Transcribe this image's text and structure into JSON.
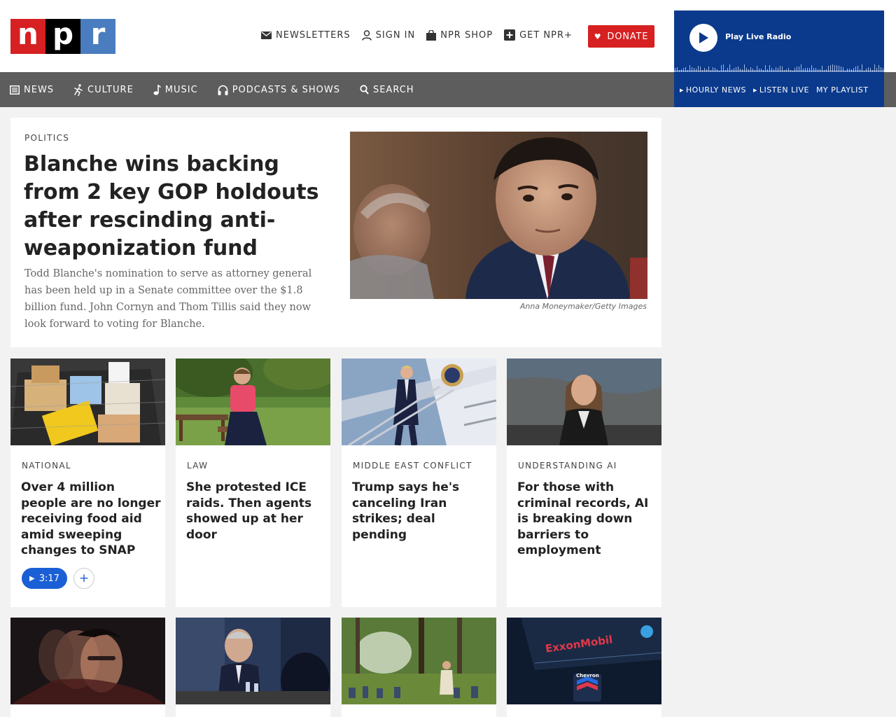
{
  "logo": {
    "n": "n",
    "p": "p",
    "r": "r"
  },
  "utility_nav": [
    {
      "label": "NEWSLETTERS",
      "icon": "envelope-icon"
    },
    {
      "label": "SIGN IN",
      "icon": "user-icon"
    },
    {
      "label": "NPR SHOP",
      "icon": "bag-icon"
    },
    {
      "label": "GET NPR+",
      "icon": "plus-square-icon"
    }
  ],
  "donate": {
    "label": "DONATE",
    "icon": "heart-icon"
  },
  "player": {
    "play_label": "Play Live Radio",
    "links": [
      "HOURLY NEWS",
      "LISTEN LIVE",
      "MY PLAYLIST"
    ]
  },
  "main_nav": [
    {
      "label": "NEWS",
      "icon": "news-icon"
    },
    {
      "label": "CULTURE",
      "icon": "culture-icon"
    },
    {
      "label": "MUSIC",
      "icon": "music-note-icon"
    },
    {
      "label": "PODCASTS & SHOWS",
      "icon": "headphones-icon"
    },
    {
      "label": "SEARCH",
      "icon": "search-icon"
    }
  ],
  "lead_story": {
    "category": "POLITICS",
    "title": "Blanche wins backing from 2 key GOP holdouts after rescinding anti-weaponization fund",
    "teaser": "Todd Blanche's nomination to serve as attorney general has been held up in a Senate committee over the $1.8 billion fund. John Cornyn and Thom Tillis said they now look forward to voting for Blanche.",
    "credit": "Anna Moneymaker/Getty Images"
  },
  "cards": [
    {
      "category": "NATIONAL",
      "title": "Over 4 million people are no longer receiving food aid amid sweeping changes to SNAP",
      "audio_duration": "3:17",
      "add_label": "+"
    },
    {
      "category": "LAW",
      "title": "She protested ICE raids. Then agents showed up at her door"
    },
    {
      "category": "MIDDLE EAST CONFLICT",
      "title": "Trump says he's canceling Iran strikes; deal pending"
    },
    {
      "category": "UNDERSTANDING AI",
      "title": "For those with criminal records, AI is breaking down barriers to employment"
    }
  ],
  "image_overlays": {
    "exxon": "ExxonMobil",
    "chevron": "Chevron"
  }
}
